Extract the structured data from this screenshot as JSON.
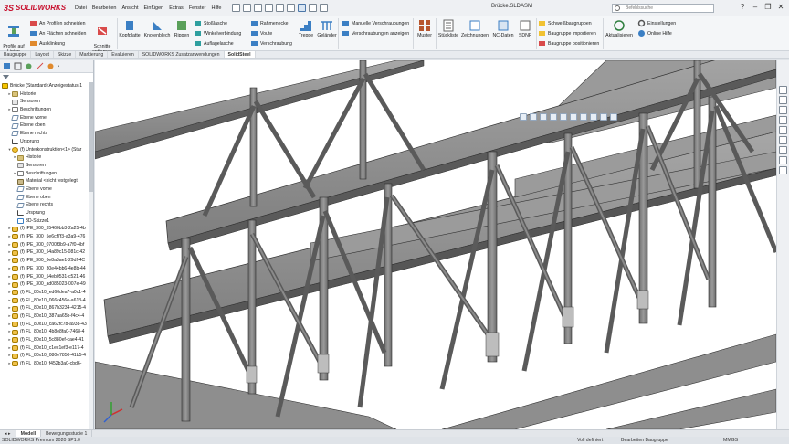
{
  "app": {
    "logo_text": "SOLIDWORKS",
    "document_title": "Brücke.SLDASM",
    "search_placeholder": "Befehlssuche"
  },
  "menu": [
    "Datei",
    "Bearbeiten",
    "Ansicht",
    "Einfügen",
    "Extras",
    "Fenster",
    "Hilfe"
  ],
  "ribbon": {
    "profile_label": "Profile auf\nLinien",
    "profile_end_cut": "An Profilen schneiden",
    "surface_cut": "An Flächen schneiden",
    "notch": "Ausklinkung",
    "remove_cuts": "Schnitte\nentfernen",
    "endcap": "Kopfplatte",
    "gusset_plate": "Knotenblech",
    "rib": "Rippen",
    "butt_strap": "Stoßlasche",
    "angle_connection": "Winkelverbindung",
    "base_plate": "Auflagelasche",
    "frame_corner": "Rahmenecke",
    "haunch": "Voute",
    "bolting": "Verschraubung",
    "stairs": "Treppe",
    "railing": "Geländer",
    "manual_bolting": "Manuelle Verschraubungen",
    "show_bolting": "Verschraubungen anzeigen",
    "pattern": "Muster",
    "bom": "Stückliste",
    "drawings": "Zeichnungen",
    "nc_data": "NC-Daten",
    "sdnf": "SDNF",
    "weld_assemblies": "Schweißbaugruppen",
    "import_assembly": "Baugruppe importieren",
    "position_assembly": "Baugruppe positionieren",
    "update": "Aktualisieren",
    "settings": "Einstellungen",
    "online_help": "Online Hilfe"
  },
  "tabs": [
    "Baugruppe",
    "Layout",
    "Skizze",
    "Markierung",
    "Evaluieren",
    "SOLIDWORKS Zusatzanwendungen",
    "SolidSteel"
  ],
  "active_tab": "SolidSteel",
  "tree": {
    "root": "Brücke  (Standard<Anzeigestatus-1",
    "items": [
      {
        "label": "Historie",
        "icon": "folder",
        "indent": 1,
        "expand": "▸"
      },
      {
        "label": "Sensoren",
        "icon": "sensor",
        "indent": 1,
        "expand": ""
      },
      {
        "label": "Beschriftungen",
        "icon": "note",
        "indent": 1,
        "expand": "▸"
      },
      {
        "label": "Ebene vorne",
        "icon": "plane",
        "indent": 1,
        "expand": ""
      },
      {
        "label": "Ebene oben",
        "icon": "plane",
        "indent": 1,
        "expand": ""
      },
      {
        "label": "Ebene rechts",
        "icon": "plane",
        "indent": 1,
        "expand": ""
      },
      {
        "label": "Ursprung",
        "icon": "origin",
        "indent": 1,
        "expand": ""
      },
      {
        "label": "(f) Unterkonstruktion<1> (Star",
        "icon": "asm",
        "indent": 1,
        "expand": "▾"
      },
      {
        "label": "Historie",
        "icon": "folder",
        "indent": 2,
        "expand": "▸"
      },
      {
        "label": "Sensoren",
        "icon": "sensor",
        "indent": 2,
        "expand": ""
      },
      {
        "label": "Beschriftungen",
        "icon": "note",
        "indent": 2,
        "expand": "▸"
      },
      {
        "label": "Material <nicht festgelegt",
        "icon": "material",
        "indent": 2,
        "expand": ""
      },
      {
        "label": "Ebene vorne",
        "icon": "plane",
        "indent": 2,
        "expand": ""
      },
      {
        "label": "Ebene oben",
        "icon": "plane",
        "indent": 2,
        "expand": ""
      },
      {
        "label": "Ebene rechts",
        "icon": "plane",
        "indent": 2,
        "expand": ""
      },
      {
        "label": "Ursprung",
        "icon": "origin",
        "indent": 2,
        "expand": ""
      },
      {
        "label": "3D-Skizze1",
        "icon": "sketch",
        "indent": 2,
        "expand": ""
      },
      {
        "label": "(f) IPE_300_35460bb3-2a25-4b",
        "icon": "part",
        "indent": 1,
        "expand": "▸"
      },
      {
        "label": "(f) IPE_300_5e6cf7f3-a3a9-476",
        "icon": "part",
        "indent": 1,
        "expand": "▸"
      },
      {
        "label": "(f) IPE_300_0700f3b9-a7f0-4bf",
        "icon": "part",
        "indent": 1,
        "expand": "▸"
      },
      {
        "label": "(f) IPE_300_54a89c15-081c-42",
        "icon": "part",
        "indent": 1,
        "expand": "▸"
      },
      {
        "label": "(f) IPE_300_6e8a3ae1-29df-4C",
        "icon": "part",
        "indent": 1,
        "expand": "▸"
      },
      {
        "label": "(f) IPE_300_30e44bb6-4e8b-44",
        "icon": "part",
        "indent": 1,
        "expand": "▸"
      },
      {
        "label": "(f) IPE_300_54eb0531-c521-46",
        "icon": "part",
        "indent": 1,
        "expand": "▸"
      },
      {
        "label": "(f) IPE_300_ad085023-007e-49",
        "icon": "part",
        "indent": 1,
        "expand": "▸"
      },
      {
        "label": "(f) FL_80x10_ed60dea7-a0c1-4",
        "icon": "part",
        "indent": 1,
        "expand": "▸"
      },
      {
        "label": "(f) FL_80x10_066c456e-a613-4",
        "icon": "part",
        "indent": 1,
        "expand": "▸"
      },
      {
        "label": "(f) FL_80x10_867b3234-4215-4",
        "icon": "part",
        "indent": 1,
        "expand": "▸"
      },
      {
        "label": "(f) FL_80x10_387aa65b-f4c4-4",
        "icon": "part",
        "indent": 1,
        "expand": "▸"
      },
      {
        "label": "(f) FL_80x10_ca62fc7b-a938-43",
        "icon": "part",
        "indent": 1,
        "expand": "▸"
      },
      {
        "label": "(f) FL_80x10_4b8e8fa0-7468-4",
        "icon": "part",
        "indent": 1,
        "expand": "▸"
      },
      {
        "label": "(f) FL_80x10_5c880ef-cae4-41",
        "icon": "part",
        "indent": 1,
        "expand": "▸"
      },
      {
        "label": "(f) FL_80x10_c1ec1ef3-e117-4",
        "icon": "part",
        "indent": 1,
        "expand": "▸"
      },
      {
        "label": "(f) FL_80x10_080e7850-41b5-4",
        "icon": "part",
        "indent": 1,
        "expand": "▸"
      },
      {
        "label": "(f) FL_80x10_f452b3a0-cbd6-",
        "icon": "part",
        "indent": 1,
        "expand": "▸"
      }
    ]
  },
  "bottom_tabs": [
    "Modell",
    "Bewegungsstudie 1"
  ],
  "active_bottom_tab": "Modell",
  "status": {
    "version": "SOLIDWORKS Premium 2020 SP1.0",
    "defined": "Voll definiert",
    "editing": "Bearbeiten Baugruppe",
    "units": "MMGS"
  },
  "colors": {
    "accent": "#c8102e",
    "steel": "#8c8c8c",
    "steel_dark": "#4d4d4d"
  }
}
